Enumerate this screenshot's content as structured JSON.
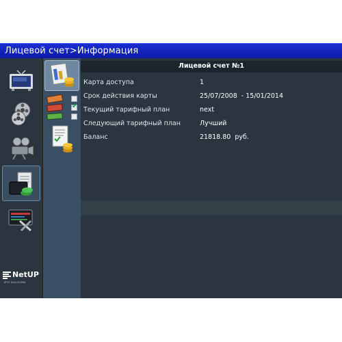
{
  "window": {
    "title": "Лицевой счет>Информация"
  },
  "nav": {
    "items": [
      {
        "name": "tv",
        "icon": "tv-icon",
        "active": false
      },
      {
        "name": "video",
        "icon": "film-reels-icon",
        "active": false
      },
      {
        "name": "cinema",
        "icon": "projector-icon",
        "active": false
      },
      {
        "name": "account",
        "icon": "wallet-documents-icon",
        "active": true
      },
      {
        "name": "settings",
        "icon": "screen-tools-icon",
        "active": false
      }
    ],
    "logo": {
      "text": "NetUP",
      "tagline": "IPTV SOLUTIONS"
    }
  },
  "subnav": {
    "items": [
      {
        "icon": "account-info-icon",
        "active": true
      },
      {
        "icon": "tariff-ticket-icon",
        "checked": false
      },
      {
        "icon": "tariff-ticket-icon",
        "checked": true
      },
      {
        "icon": "tariff-ticket-icon",
        "checked": false
      },
      {
        "icon": "payments-document-icon"
      }
    ]
  },
  "account": {
    "header": "Лицевой счет №1",
    "rows": [
      {
        "label": "Карта доступа",
        "value": "1"
      },
      {
        "label": "Срок действия карты",
        "value": "25/07/2008  - 15/01/2014"
      },
      {
        "label": "Текущий тарифный план",
        "value": "next"
      },
      {
        "label": "Следующий тарифный план",
        "value": "Лучший"
      },
      {
        "label": "Баланс",
        "value": "21818.80  руб."
      }
    ]
  },
  "colors": {
    "titlebar": "#1222c4",
    "panel": "#2b3540",
    "header": "#1c252e",
    "accent": "#6f88a2"
  }
}
